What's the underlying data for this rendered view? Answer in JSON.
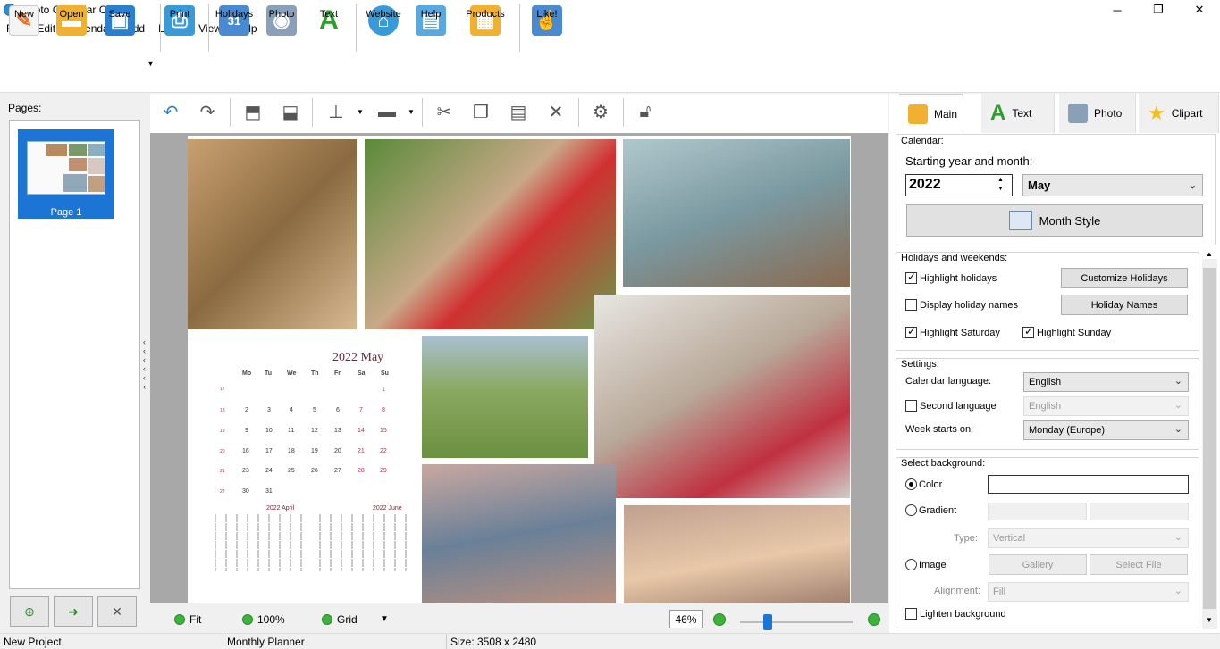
{
  "window": {
    "title": "Photo Calendar Creator"
  },
  "menu": [
    "File",
    "Edit",
    "Calendar",
    "Add",
    "Layer",
    "View",
    "Help"
  ],
  "toolbar": {
    "new": "New",
    "open": "Open",
    "save": "Save",
    "print": "Print",
    "holidays": "Holidays",
    "photo": "Photo",
    "text": "Text",
    "website": "Website",
    "help": "Help",
    "products": "Products",
    "like": "Like!"
  },
  "pages": {
    "label": "Pages:",
    "items": [
      {
        "label": "Page 1"
      }
    ]
  },
  "calendar": {
    "title": "2022 May",
    "weekdays": [
      "Mo",
      "Tu",
      "We",
      "Th",
      "Fr",
      "Sa",
      "Su"
    ],
    "weeks": [
      [
        "17",
        "",
        "",
        "",
        "",
        "",
        "1"
      ],
      [
        "18",
        "2",
        "3",
        "4",
        "5",
        "6",
        "7",
        "8"
      ],
      [
        "19",
        "9",
        "10",
        "11",
        "12",
        "13",
        "14",
        "15"
      ],
      [
        "20",
        "16",
        "17",
        "18",
        "19",
        "20",
        "21",
        "22"
      ],
      [
        "21",
        "23",
        "24",
        "25",
        "26",
        "27",
        "28",
        "29"
      ],
      [
        "22",
        "30",
        "31"
      ]
    ],
    "mini_left_title": "2022 April",
    "mini_right_title": "2022 June"
  },
  "bottom": {
    "fit": "Fit",
    "zoom100": "100%",
    "grid": "Grid",
    "zoom_value": "46%",
    "zoom_level": 0.46
  },
  "tabs": [
    "Main",
    "Text",
    "Photo",
    "Clipart"
  ],
  "main_panel": {
    "calendar_group": "Calendar:",
    "start_label": "Starting year and month:",
    "year": "2022",
    "month": "May",
    "month_style": "Month Style",
    "holidays_group": "Holidays and weekends:",
    "highlight_holidays": "Highlight holidays",
    "display_holiday_names": "Display holiday names",
    "highlight_saturday": "Highlight Saturday",
    "highlight_sunday": "Highlight Sunday",
    "customize_holidays": "Customize Holidays",
    "holiday_names": "Holiday Names",
    "settings_group": "Settings:",
    "calendar_language": "Calendar language:",
    "calendar_language_value": "English",
    "second_language": "Second language",
    "second_language_value": "English",
    "week_starts": "Week starts on:",
    "week_starts_value": "Monday (Europe)",
    "background_group": "Select background:",
    "color": "Color",
    "gradient": "Gradient",
    "type_label": "Type:",
    "type_value": "Vertical",
    "image": "Image",
    "gallery": "Gallery",
    "select_file": "Select File",
    "alignment_label": "Alignment:",
    "alignment_value": "Fill",
    "lighten_background": "Lighten background"
  },
  "status": {
    "project": "New Project",
    "template": "Monthly Planner",
    "size": "Size: 3508 x 2480"
  },
  "colors": {
    "accent": "#1c74d4",
    "calendar_title": "#6b2836",
    "weekend": "#b03050"
  }
}
